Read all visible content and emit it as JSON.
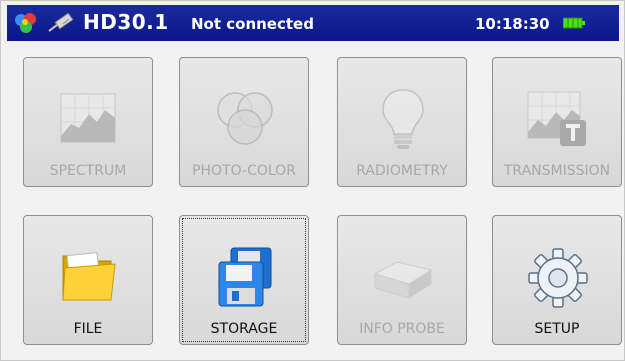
{
  "header": {
    "model": "HD30.1",
    "status": "Not connected",
    "time": "10:18:30",
    "colors": {
      "bar": "#0f1c8f",
      "battery": "#4be01c"
    }
  },
  "tiles": [
    {
      "label": "SPECTRUM",
      "icon": "spectrum-chart-icon",
      "enabled": false
    },
    {
      "label": "PHOTO-COLOR",
      "icon": "color-circles-icon",
      "enabled": false
    },
    {
      "label": "RADIOMETRY",
      "icon": "light-bulb-icon",
      "enabled": false
    },
    {
      "label": "TRANSMISSION",
      "icon": "transmission-chart-icon",
      "enabled": false
    },
    {
      "label": "FILE",
      "icon": "folder-icon",
      "enabled": true
    },
    {
      "label": "STORAGE",
      "icon": "floppy-disk-icon",
      "enabled": true,
      "selected": true
    },
    {
      "label": "INFO PROBE",
      "icon": "probe-box-icon",
      "enabled": false
    },
    {
      "label": "SETUP",
      "icon": "gear-icon",
      "enabled": true
    }
  ]
}
